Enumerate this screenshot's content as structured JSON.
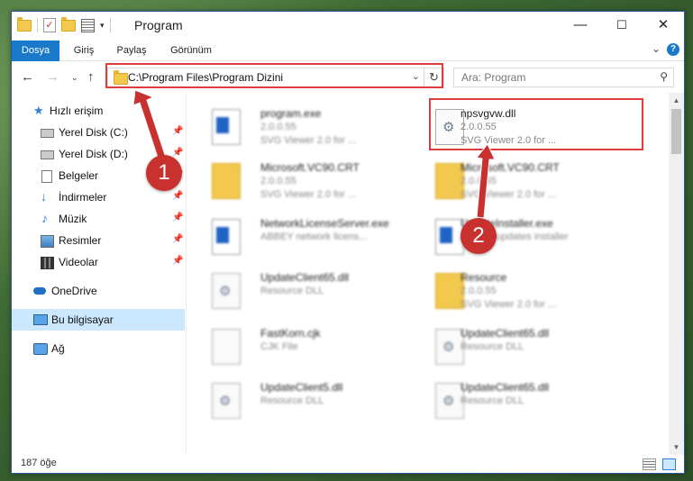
{
  "window": {
    "title": "Program",
    "minimize": "—",
    "maximize": "☐",
    "close": "✕"
  },
  "ribbon": {
    "tabs": [
      "Dosya",
      "Giriş",
      "Paylaş",
      "Görünüm"
    ],
    "help": "?"
  },
  "nav": {
    "address": "C:\\Program Files\\Program Dizini",
    "search_placeholder": "Ara: Program"
  },
  "sidebar": {
    "items": [
      {
        "label": "Hızlı erişim",
        "icon": "star-icon",
        "pinned": false
      },
      {
        "label": "Yerel Disk (C:)",
        "icon": "drive-icon",
        "pinned": true
      },
      {
        "label": "Yerel Disk (D:)",
        "icon": "drive-icon",
        "pinned": true
      },
      {
        "label": "Belgeler",
        "icon": "documents-icon",
        "pinned": true
      },
      {
        "label": "İndirmeler",
        "icon": "download-icon",
        "pinned": true
      },
      {
        "label": "Müzik",
        "icon": "music-icon",
        "pinned": true
      },
      {
        "label": "Resimler",
        "icon": "pictures-icon",
        "pinned": true
      },
      {
        "label": "Videolar",
        "icon": "videos-icon",
        "pinned": true
      },
      {
        "label": "OneDrive",
        "icon": "cloud-icon",
        "pinned": false
      },
      {
        "label": "Bu bilgisayar",
        "icon": "computer-icon",
        "pinned": false,
        "selected": true
      },
      {
        "label": "Ağ",
        "icon": "network-icon",
        "pinned": false
      }
    ]
  },
  "files": [
    {
      "name": "program.exe",
      "line2": "2.0.0.55",
      "line3": "SVG Viewer 2.0 for ...",
      "icon": "exe-icon",
      "blurred": true
    },
    {
      "name": "npsvgvw.dll",
      "line2": "2.0.0.55",
      "line3": "SVG Viewer 2.0 for ...",
      "icon": "dll-icon",
      "blurred": false
    },
    {
      "name": "Microsoft.VC90.CRT",
      "line2": "2.0.0.55",
      "line3": "SVG Viewer 2.0 for ...",
      "icon": "folder-icon",
      "blurred": true
    },
    {
      "name": "Microsoft.VC90.CRT",
      "line2": "2.0.0.55",
      "line3": "SVG Viewer 2.0 for ...",
      "icon": "folder-icon",
      "blurred": true
    },
    {
      "name": "NetworkLicenseServer.exe",
      "line2": "ABBEY network licens...",
      "line3": "",
      "icon": "exe-icon",
      "blurred": true
    },
    {
      "name": "UpdateInstaller.exe",
      "line2": "ABBEY updates installer",
      "line3": "",
      "icon": "exe-icon",
      "blurred": true
    },
    {
      "name": "UpdateClient65.dll",
      "line2": "Resource DLL",
      "line3": "",
      "icon": "dll-icon",
      "blurred": true
    },
    {
      "name": "Resource",
      "line2": "2.0.0.55",
      "line3": "SVG Viewer 2.0 for ...",
      "icon": "folder-icon",
      "blurred": true
    },
    {
      "name": "FastKorn.cjk",
      "line2": "CJK File",
      "line3": "",
      "icon": "file-icon",
      "blurred": true
    },
    {
      "name": "UpdateClient65.dll",
      "line2": "Resource DLL",
      "line3": "",
      "icon": "dll-icon",
      "blurred": true
    },
    {
      "name": "UpdateClient5.dll",
      "line2": "Resource DLL",
      "line3": "",
      "icon": "dll-icon",
      "blurred": true
    },
    {
      "name": "UpdateClient65.dll",
      "line2": "Resource DLL",
      "line3": "",
      "icon": "dll-icon",
      "blurred": true
    }
  ],
  "status": {
    "count": "187 öğe"
  },
  "annotations": {
    "step1": "1",
    "step2": "2",
    "color": "#c8312e"
  }
}
